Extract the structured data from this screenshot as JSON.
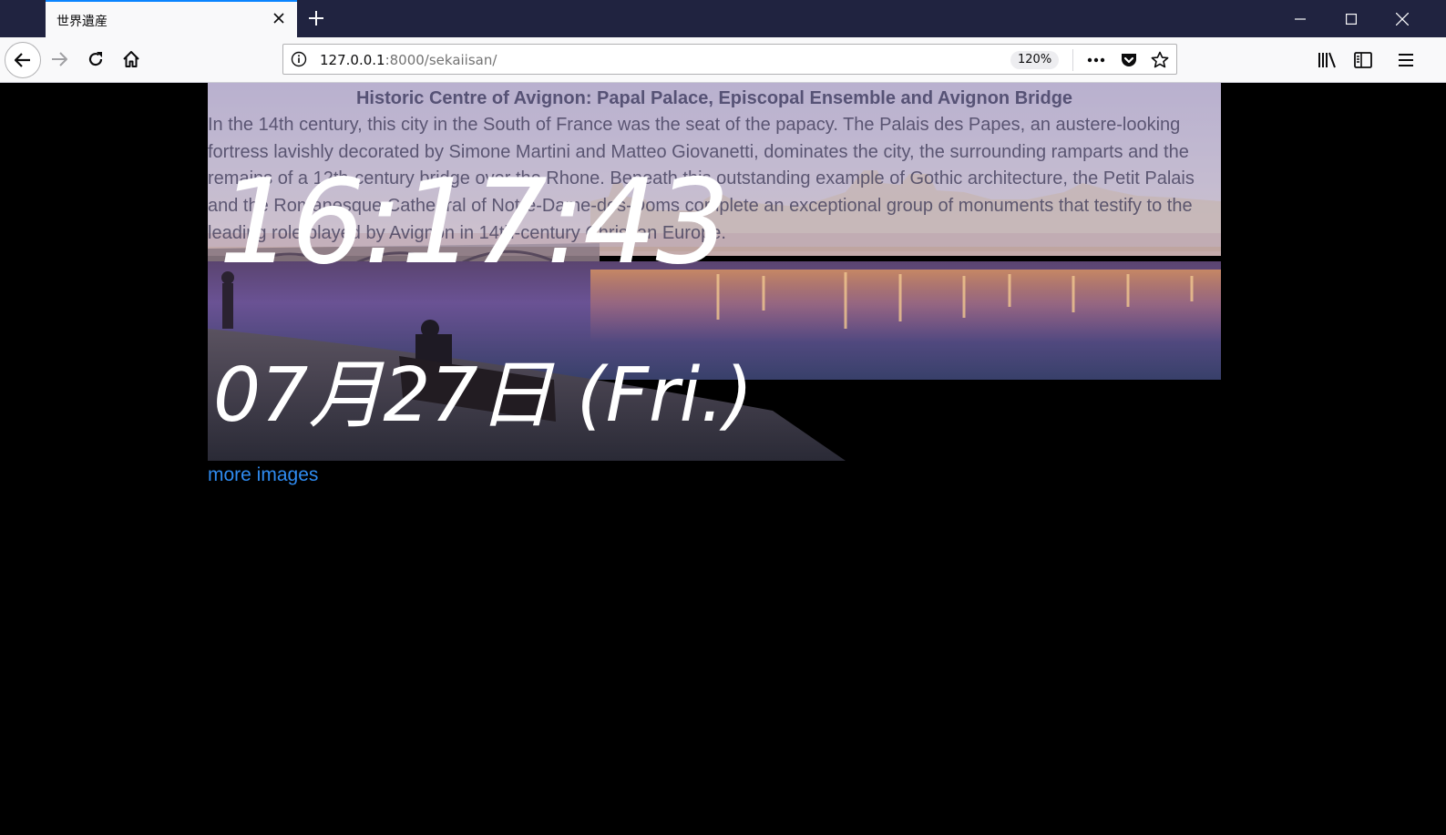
{
  "browser": {
    "tab_title": "世界遺産",
    "url_host": "127.0.0.1",
    "url_rest": ":8000/sekaiisan/",
    "zoom": "120%"
  },
  "page": {
    "site_title": "Historic Centre of Avignon: Papal Palace, Episcopal Ensemble and Avignon Bridge",
    "description": "In the 14th century, this city in the South of France was the seat of the papacy. The Palais des Papes, an austere-looking fortress lavishly decorated by Simone Martini and Matteo Giovanetti, dominates the city, the surrounding ramparts and the remains of a 12th-century bridge over the Rhone. Beneath this outstanding example of Gothic architecture, the Petit Palais and the Romanesque Cathedral of Notre-Dame-des-Doms complete an exceptional group of monuments that testify to the leading role played by Avignon in 14th-century Christian Europe.",
    "clock_time": "16:17:43",
    "clock_date": "07月27日 (Fri.)",
    "more_link": "more images"
  },
  "colors": {
    "tabbar": "#202340",
    "accent": "#0a84ff",
    "link": "#2f8bf0"
  }
}
